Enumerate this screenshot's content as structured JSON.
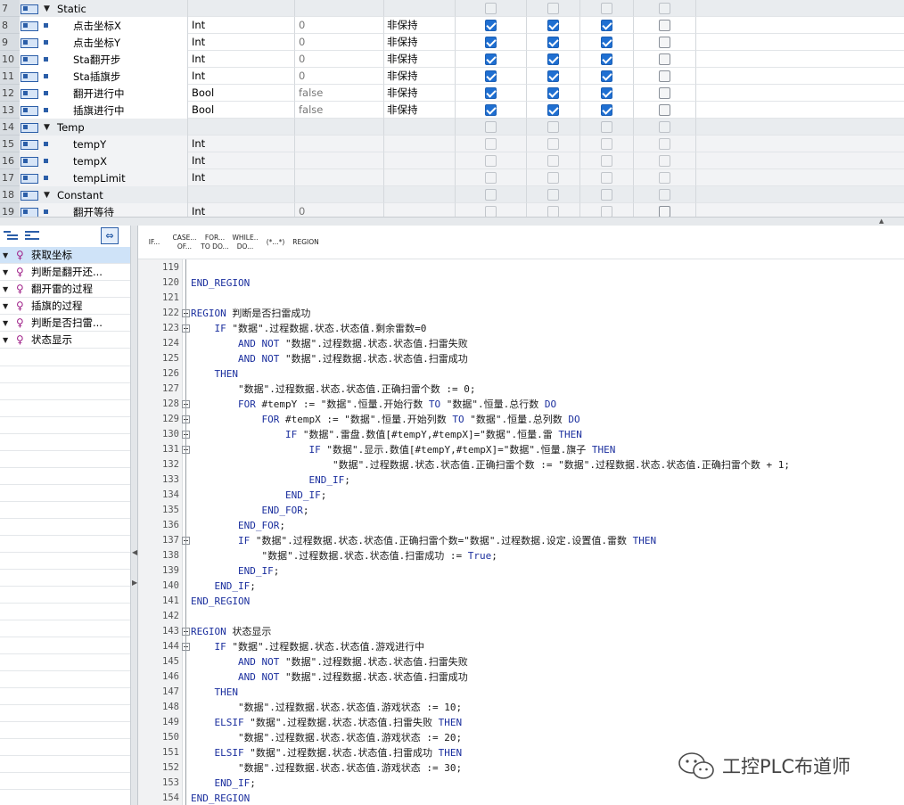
{
  "declaration_rows": [
    {
      "row": "7",
      "kind": "section",
      "name": "Static",
      "type": "",
      "default": "",
      "retain": "",
      "checks": [
        false,
        false,
        false,
        false
      ],
      "dim": [
        true,
        true,
        true,
        true
      ]
    },
    {
      "row": "8",
      "kind": "var",
      "name": "点击坐标X",
      "type": "Int",
      "default": "0",
      "retain": "非保持",
      "checks": [
        true,
        true,
        true,
        false
      ],
      "dim": [
        false,
        false,
        false,
        false
      ]
    },
    {
      "row": "9",
      "kind": "var",
      "name": "点击坐标Y",
      "type": "Int",
      "default": "0",
      "retain": "非保持",
      "checks": [
        true,
        true,
        true,
        false
      ],
      "dim": [
        false,
        false,
        false,
        false
      ]
    },
    {
      "row": "10",
      "kind": "var",
      "name": "Sta翻开步",
      "type": "Int",
      "default": "0",
      "retain": "非保持",
      "checks": [
        true,
        true,
        true,
        false
      ],
      "dim": [
        false,
        false,
        false,
        false
      ]
    },
    {
      "row": "11",
      "kind": "var",
      "name": "Sta插旗步",
      "type": "Int",
      "default": "0",
      "retain": "非保持",
      "checks": [
        true,
        true,
        true,
        false
      ],
      "dim": [
        false,
        false,
        false,
        false
      ]
    },
    {
      "row": "12",
      "kind": "var",
      "name": "翻开进行中",
      "type": "Bool",
      "default": "false",
      "retain": "非保持",
      "checks": [
        true,
        true,
        true,
        false
      ],
      "dim": [
        false,
        false,
        false,
        false
      ]
    },
    {
      "row": "13",
      "kind": "var",
      "name": "插旗进行中",
      "type": "Bool",
      "default": "false",
      "retain": "非保持",
      "checks": [
        true,
        true,
        true,
        false
      ],
      "dim": [
        false,
        false,
        false,
        false
      ]
    },
    {
      "row": "14",
      "kind": "section",
      "name": "Temp",
      "type": "",
      "default": "",
      "retain": "",
      "checks": [
        false,
        false,
        false,
        false
      ],
      "dim": [
        true,
        true,
        true,
        true
      ]
    },
    {
      "row": "15",
      "kind": "var",
      "name": "tempY",
      "type": "Int",
      "default": "",
      "retain": "",
      "checks": [
        false,
        false,
        false,
        false
      ],
      "dim": [
        true,
        true,
        true,
        true
      ]
    },
    {
      "row": "16",
      "kind": "var",
      "name": "tempX",
      "type": "Int",
      "default": "",
      "retain": "",
      "checks": [
        false,
        false,
        false,
        false
      ],
      "dim": [
        true,
        true,
        true,
        true
      ]
    },
    {
      "row": "17",
      "kind": "var",
      "name": "tempLimit",
      "type": "Int",
      "default": "",
      "retain": "",
      "checks": [
        false,
        false,
        false,
        false
      ],
      "dim": [
        true,
        true,
        true,
        true
      ]
    },
    {
      "row": "18",
      "kind": "section",
      "name": "Constant",
      "type": "",
      "default": "",
      "retain": "",
      "checks": [
        false,
        false,
        false,
        false
      ],
      "dim": [
        true,
        true,
        true,
        true
      ]
    },
    {
      "row": "19",
      "kind": "var",
      "name": "翻开等待",
      "type": "Int",
      "default": "0",
      "retain": "",
      "checks": [
        false,
        false,
        false,
        false
      ],
      "dim": [
        true,
        true,
        true,
        false
      ]
    }
  ],
  "outline": {
    "items": [
      {
        "label": "获取坐标",
        "selected": true
      },
      {
        "label": "判断是翻开还...",
        "selected": false
      },
      {
        "label": "翻开雷的过程",
        "selected": false
      },
      {
        "label": "插旗的过程",
        "selected": false
      },
      {
        "label": "判断是否扫雷...",
        "selected": false
      },
      {
        "label": "状态显示",
        "selected": false
      }
    ]
  },
  "editor_toolbar": [
    {
      "line1": "IF...",
      "line2": ""
    },
    {
      "line1": "CASE...",
      "line2": "OF..."
    },
    {
      "line1": "FOR...",
      "line2": "TO DO..."
    },
    {
      "line1": "WHILE..",
      "line2": "DO..."
    },
    {
      "line1": "(*...*)",
      "line2": ""
    },
    {
      "line1": "REGION",
      "line2": ""
    }
  ],
  "code_lines": [
    {
      "n": "119",
      "fold": false,
      "text": ""
    },
    {
      "n": "120",
      "fold": false,
      "text": "END_REGION"
    },
    {
      "n": "121",
      "fold": false,
      "text": ""
    },
    {
      "n": "122",
      "fold": true,
      "text": "REGION 判断是否扫雷成功"
    },
    {
      "n": "123",
      "fold": true,
      "text": "    IF \"数据\".过程数据.状态.状态值.剩余雷数=0"
    },
    {
      "n": "124",
      "fold": false,
      "text": "        AND NOT \"数据\".过程数据.状态.状态值.扫雷失败"
    },
    {
      "n": "125",
      "fold": false,
      "text": "        AND NOT \"数据\".过程数据.状态.状态值.扫雷成功"
    },
    {
      "n": "126",
      "fold": false,
      "text": "    THEN"
    },
    {
      "n": "127",
      "fold": false,
      "text": "        \"数据\".过程数据.状态.状态值.正确扫雷个数 := 0;"
    },
    {
      "n": "128",
      "fold": true,
      "text": "        FOR #tempY := \"数据\".恒量.开始行数 TO \"数据\".恒量.总行数 DO"
    },
    {
      "n": "129",
      "fold": true,
      "text": "            FOR #tempX := \"数据\".恒量.开始列数 TO \"数据\".恒量.总列数 DO"
    },
    {
      "n": "130",
      "fold": true,
      "text": "                IF \"数据\".雷盘.数值[#tempY,#tempX]=\"数据\".恒量.雷 THEN"
    },
    {
      "n": "131",
      "fold": true,
      "text": "                    IF \"数据\".显示.数值[#tempY,#tempX]=\"数据\".恒量.旗子 THEN"
    },
    {
      "n": "132",
      "fold": false,
      "text": "                        \"数据\".过程数据.状态.状态值.正确扫雷个数 := \"数据\".过程数据.状态.状态值.正确扫雷个数 + 1;"
    },
    {
      "n": "133",
      "fold": false,
      "text": "                    END_IF;"
    },
    {
      "n": "134",
      "fold": false,
      "text": "                END_IF;"
    },
    {
      "n": "135",
      "fold": false,
      "text": "            END_FOR;"
    },
    {
      "n": "136",
      "fold": false,
      "text": "        END_FOR;"
    },
    {
      "n": "137",
      "fold": true,
      "text": "        IF \"数据\".过程数据.状态.状态值.正确扫雷个数=\"数据\".过程数据.设定.设置值.雷数 THEN"
    },
    {
      "n": "138",
      "fold": false,
      "text": "            \"数据\".过程数据.状态.状态值.扫雷成功 := True;"
    },
    {
      "n": "139",
      "fold": false,
      "text": "        END_IF;"
    },
    {
      "n": "140",
      "fold": false,
      "text": "    END_IF;"
    },
    {
      "n": "141",
      "fold": false,
      "text": "END_REGION"
    },
    {
      "n": "142",
      "fold": false,
      "text": ""
    },
    {
      "n": "143",
      "fold": true,
      "text": "REGION 状态显示"
    },
    {
      "n": "144",
      "fold": true,
      "text": "    IF \"数据\".过程数据.状态.状态值.游戏进行中"
    },
    {
      "n": "145",
      "fold": false,
      "text": "        AND NOT \"数据\".过程数据.状态.状态值.扫雷失败"
    },
    {
      "n": "146",
      "fold": false,
      "text": "        AND NOT \"数据\".过程数据.状态.状态值.扫雷成功"
    },
    {
      "n": "147",
      "fold": false,
      "text": "    THEN"
    },
    {
      "n": "148",
      "fold": false,
      "text": "        \"数据\".过程数据.状态.状态值.游戏状态 := 10;"
    },
    {
      "n": "149",
      "fold": false,
      "text": "    ELSIF \"数据\".过程数据.状态.状态值.扫雷失败 THEN"
    },
    {
      "n": "150",
      "fold": false,
      "text": "        \"数据\".过程数据.状态.状态值.游戏状态 := 20;"
    },
    {
      "n": "151",
      "fold": false,
      "text": "    ELSIF \"数据\".过程数据.状态.状态值.扫雷成功 THEN"
    },
    {
      "n": "152",
      "fold": false,
      "text": "        \"数据\".过程数据.状态.状态值.游戏状态 := 30;"
    },
    {
      "n": "153",
      "fold": false,
      "text": "    END_IF;"
    },
    {
      "n": "154",
      "fold": false,
      "text": "END_REGION"
    }
  ],
  "watermark": {
    "text": "工控PLC布道师"
  },
  "colors": {
    "keyword": "#1b2f9e",
    "checkbox_on": "#1f6fd1",
    "selected_row": "#cfe3f8"
  }
}
